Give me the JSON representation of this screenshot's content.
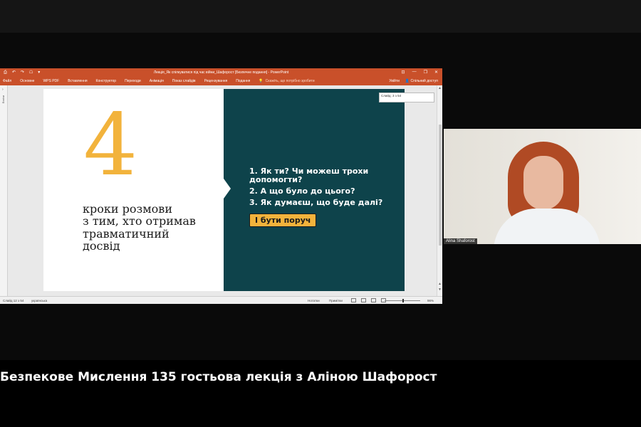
{
  "ppt": {
    "doc_title": "Лекція_Як спілкуватися під час війни_Шафорост [Безпечне подання] - PowerPoint",
    "quick_access": [
      "⎙",
      "↶",
      "↷",
      "☖",
      "▾"
    ],
    "window_controls": [
      "⊡",
      "—",
      "❐",
      "✕"
    ],
    "tabs": [
      "Файл",
      "Основне",
      "WPS PDF",
      "Вставлення",
      "Конструктор",
      "Переходи",
      "Анімація",
      "Показ слайдів",
      "Рецензування",
      "Подання"
    ],
    "tell_me": "Скажіть, що потрібно зробити",
    "login": "Увійти",
    "share": "Спільний доступ",
    "side_pane_label": "Ескізи",
    "slide_counter_box": "Слайд: 3 з 54"
  },
  "slide": {
    "big_number": "4",
    "left_text": [
      "кроки розмови",
      "з тим, хто отримав",
      "травматичний",
      "досвід"
    ],
    "questions": [
      "1. Як ти? Чи можеш трохи допомогти?",
      "2. А що було до цього?",
      "3. Як думаєш, що буде далі?"
    ],
    "cta": "І бути поруч"
  },
  "status": {
    "slide_num": "Слайд 12 з 54",
    "language": "українська",
    "notes": "Нотатки",
    "comments": "Примітки",
    "zoom": "96%"
  },
  "webcam": {
    "participant_name": "Alina Shaforost"
  },
  "caption": "Безпекове Мислення 135 гостьова лекція з Аліною Шафорост",
  "colors": {
    "ppt_orange": "#c9502a",
    "slide_dark": "#0e434b",
    "accent_yellow": "#f2b33c"
  }
}
